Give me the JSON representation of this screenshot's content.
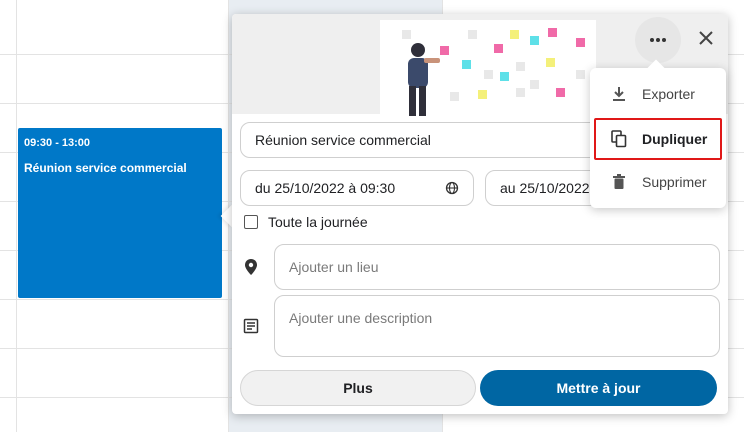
{
  "colors": {
    "event_blue": "#0078c8",
    "primary_button": "#0066a3",
    "highlight_border": "#e01818"
  },
  "event": {
    "time": "09:30 - 13:00",
    "title": "Réunion service commercial"
  },
  "popup": {
    "title_value": "Réunion service commercial",
    "start_date": "du 25/10/2022 à 09:30",
    "end_date": "au 25/10/2022",
    "all_day_label": "Toute la journée",
    "location_placeholder": "Ajouter un lieu",
    "description_placeholder": "Ajouter une description",
    "buttons": {
      "more": "Plus",
      "update": "Mettre à jour"
    },
    "icons": {
      "more": "more-horizontal-icon",
      "close": "close-icon",
      "timezone": "globe-icon",
      "location": "location-pin-icon",
      "description": "notes-icon"
    }
  },
  "menu": {
    "items": [
      {
        "label": "Exporter",
        "icon": "download-icon"
      },
      {
        "label": "Dupliquer",
        "icon": "duplicate-icon"
      },
      {
        "label": "Supprimer",
        "icon": "trash-icon"
      }
    ]
  }
}
